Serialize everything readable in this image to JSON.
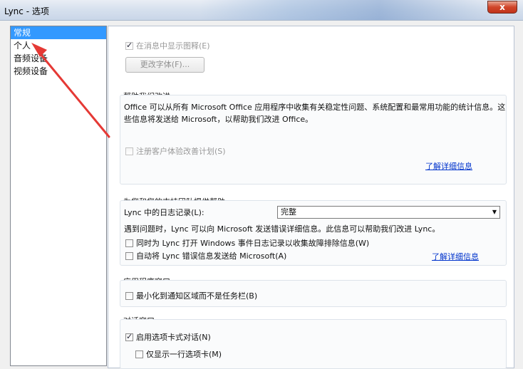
{
  "window": {
    "title": "Lync - 选项",
    "close_label": "x"
  },
  "sidebar": {
    "items": [
      {
        "label": "常规",
        "selected": true
      },
      {
        "label": "个人",
        "selected": false
      },
      {
        "label": "音频设备",
        "selected": false
      },
      {
        "label": "视频设备",
        "selected": false
      }
    ]
  },
  "general": {
    "show_emoticons": {
      "label": "在消息中显示图释(E)",
      "checked": true,
      "disabled": true
    },
    "change_font_button": "更改字体(F)..."
  },
  "improve": {
    "heading": "帮助我们改进",
    "description_line1": "Office 可以从所有 Microsoft Office 应用程序中收集有关稳定性问题、系统配置和最常用功能的统计信息。这",
    "description_line2": "些信息将发送给 Microsoft，以帮助我们改进 Office。",
    "ceip": {
      "label": "注册客户体验改善计划(S)",
      "checked": false,
      "disabled": true
    },
    "learn_more": "了解详细信息"
  },
  "support": {
    "heading": "为您和您的支持团队提供帮助",
    "logging_label": "Lync 中的日志记录(L):",
    "logging_value": "完整",
    "description": "遇到问题时，Lync 可以向 Microsoft 发送错误详细信息。此信息可以帮助我们改进 Lync。",
    "windows_log": {
      "label": "同时为 Lync 打开 Windows 事件日志记录以收集故障排除信息(W)",
      "checked": false
    },
    "auto_send": {
      "label": "自动将 Lync 错误信息发送给 Microsoft(A)",
      "checked": false
    },
    "learn_more": "了解详细信息"
  },
  "app_window": {
    "heading": "应用程序窗口",
    "minimize_tray": {
      "label": "最小化到通知区域而不是任务栏(B)",
      "checked": false
    }
  },
  "conversation": {
    "heading": "对话窗口",
    "tabbed": {
      "label": "启用选项卡式对话(N)",
      "checked": true
    },
    "single_row": {
      "label": "仅显示一行选项卡(M)",
      "checked": false
    }
  },
  "colors": {
    "selection": "#3399ff",
    "link": "#0033cc",
    "annotation_arrow": "#e53935"
  }
}
